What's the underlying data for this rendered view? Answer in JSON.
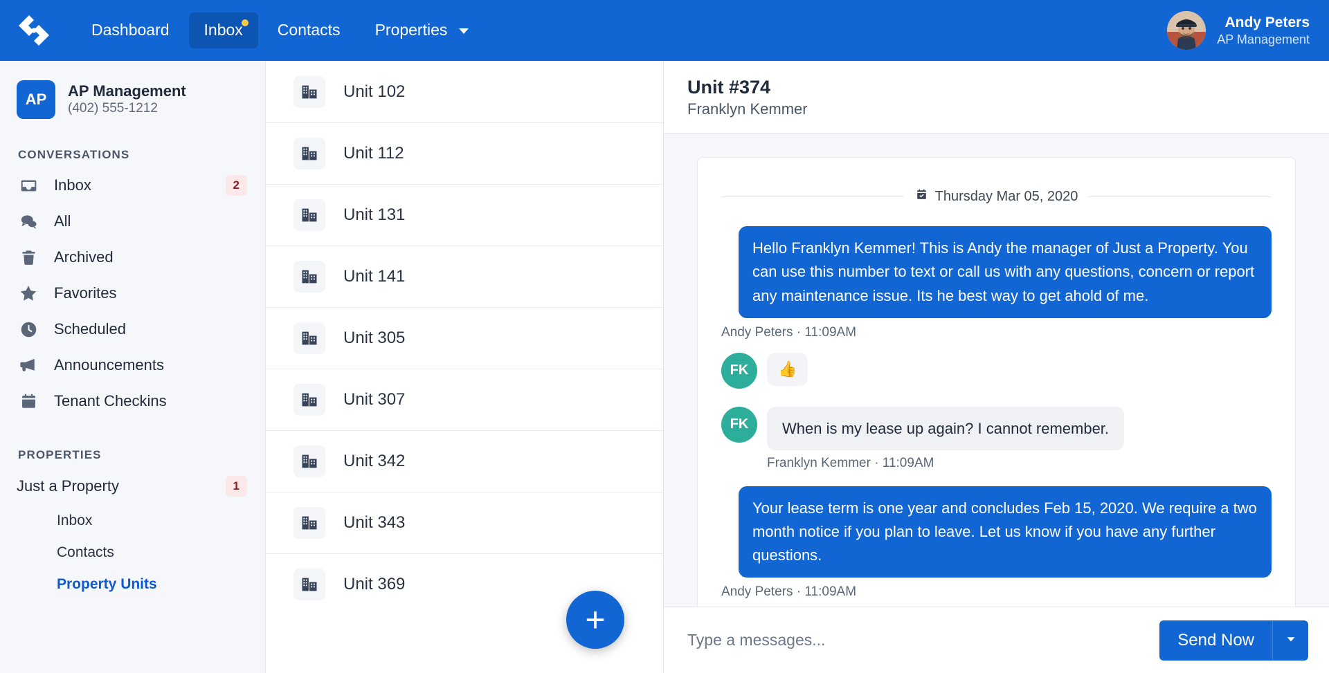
{
  "topnav": {
    "logo_icon": "brand-diamond-logo",
    "items": [
      {
        "label": "Dashboard",
        "active": false,
        "dot": false,
        "caret": false
      },
      {
        "label": "Inbox",
        "active": true,
        "dot": true,
        "caret": false
      },
      {
        "label": "Contacts",
        "active": false,
        "dot": false,
        "caret": false
      },
      {
        "label": "Properties",
        "active": false,
        "dot": false,
        "caret": true
      }
    ],
    "user": {
      "name": "Andy Peters",
      "org": "AP Management",
      "avatar_icon": "user-avatar-photo"
    }
  },
  "sidebar": {
    "org": {
      "initials": "AP",
      "name": "AP Management",
      "phone": "(402) 555-1212"
    },
    "conversations_label": "CONVERSATIONS",
    "conversations": [
      {
        "label": "Inbox",
        "icon": "inbox-icon",
        "badge": "2"
      },
      {
        "label": "All",
        "icon": "chat-bubbles-icon",
        "badge": ""
      },
      {
        "label": "Archived",
        "icon": "trash-icon",
        "badge": ""
      },
      {
        "label": "Favorites",
        "icon": "star-icon",
        "badge": ""
      },
      {
        "label": "Scheduled",
        "icon": "clock-icon",
        "badge": ""
      },
      {
        "label": "Announcements",
        "icon": "megaphone-icon",
        "badge": ""
      },
      {
        "label": "Tenant Checkins",
        "icon": "calendar-icon",
        "badge": ""
      }
    ],
    "properties_label": "PROPERTIES",
    "property": {
      "name": "Just a Property",
      "badge": "1"
    },
    "property_subitems": [
      {
        "label": "Inbox",
        "active": false
      },
      {
        "label": "Contacts",
        "active": false
      },
      {
        "label": "Property Units",
        "active": true
      }
    ]
  },
  "units": {
    "icon": "building-icon",
    "add_button_label": "+",
    "items": [
      {
        "label": "Unit 102"
      },
      {
        "label": "Unit 112"
      },
      {
        "label": "Unit 131"
      },
      {
        "label": "Unit 141"
      },
      {
        "label": "Unit 305"
      },
      {
        "label": "Unit 307"
      },
      {
        "label": "Unit 342"
      },
      {
        "label": "Unit 343"
      },
      {
        "label": "Unit 369"
      }
    ]
  },
  "conversation": {
    "title": "Unit #374",
    "subtitle": "Franklyn Kemmer",
    "date_divider": "Thursday Mar 05, 2020",
    "date_icon": "calendar-check-icon",
    "messages": [
      {
        "direction": "out",
        "text": "Hello Franklyn Kemmer! This is Andy the manager of Just a Property. You can use this number to text or call us with any questions, concern or report any maintenance issue. Its he best way to get ahold of me.",
        "meta": "Andy Peters · 11:09AM"
      },
      {
        "direction": "reaction",
        "initials": "FK",
        "text": "👍",
        "meta": ""
      },
      {
        "direction": "in",
        "initials": "FK",
        "text": "When is my lease up again? I cannot remember.",
        "meta": "Franklyn Kemmer · 11:09AM"
      },
      {
        "direction": "out",
        "text": "Your lease term is one year and concludes Feb 15, 2020. We require a two month notice if you plan to leave. Let us know if you have any further questions.",
        "meta": "Andy Peters · 11:09AM"
      }
    ],
    "composer": {
      "placeholder": "Type a messages...",
      "value": "",
      "send_label": "Send Now",
      "send_caret_icon": "chevron-down-icon"
    }
  },
  "colors": {
    "brand_blue": "#1266d4",
    "nav_active": "#0d55b3",
    "dot_yellow": "#f7c948",
    "badge_bg": "#fbe9ea",
    "badge_text": "#8a1f2a",
    "avatar_teal": "#2cae9b",
    "sidebar_bg": "#f6f7fb",
    "link_blue": "#0d5ad0"
  }
}
